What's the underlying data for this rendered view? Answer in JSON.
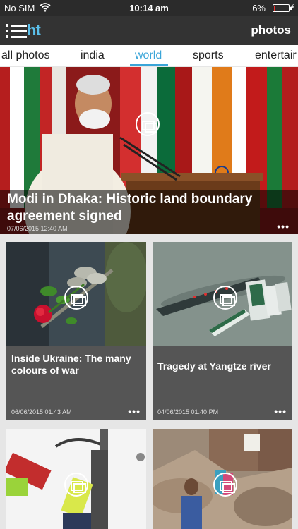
{
  "status_bar": {
    "carrier": "No SIM",
    "time": "10:14 am",
    "battery": "6%",
    "battery_level": 0.06,
    "icons": [
      "wifi-icon",
      "battery-icon",
      "charging-icon"
    ]
  },
  "header": {
    "logo": "ht",
    "title": "photos",
    "icons": [
      "menu-icon"
    ]
  },
  "tabs": {
    "items": [
      "all photos",
      "india",
      "world",
      "sports",
      "entertair"
    ],
    "active": "world"
  },
  "hero": {
    "title": "Modi in Dhaka: Historic land boundary agreement signed",
    "date": "07/06/2015 12:40 AM",
    "more": "•••"
  },
  "cards": [
    {
      "title": "Inside Ukraine: The many colours of war",
      "date": "06/06/2015 01:43 AM",
      "more": "•••"
    },
    {
      "title": "Tragedy at Yangtze river",
      "date": "04/06/2015 01:40 PM",
      "more": "•••"
    }
  ],
  "colors": {
    "accent": "#3aa5d8",
    "header_bg": "#333333",
    "card_bg": "#555555",
    "logo": "#5bc0eb"
  }
}
